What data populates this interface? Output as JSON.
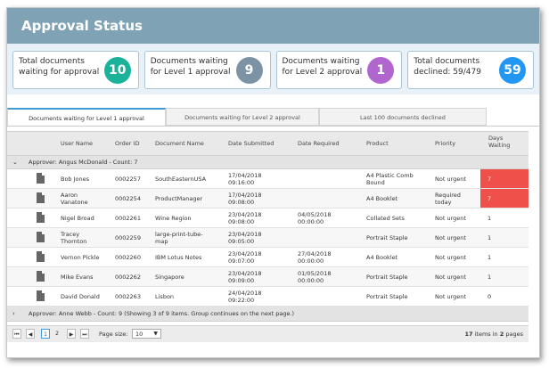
{
  "app_title": "Approval Status",
  "cards": [
    {
      "label_line1": "Total documents",
      "label_line2": "waiting for approval",
      "count": "10",
      "color": "#1ab39a"
    },
    {
      "label_line1": "Documents waiting",
      "label_line2": "for Level 1 approval",
      "count": "9",
      "color": "#7b93a4"
    },
    {
      "label_line1": "Documents waiting",
      "label_line2": "for Level 2 approval",
      "count": "1",
      "color": "#b166cf"
    },
    {
      "label_line1": "Total documents",
      "label_line2": "declined: 59/479",
      "count": "59",
      "color": "#2196f3"
    }
  ],
  "tabs": [
    {
      "label": "Documents waiting for Level 1 approval",
      "active": true
    },
    {
      "label": "Documents waiting for Level 2 approval",
      "active": false
    },
    {
      "label": "Last 100 documents declined",
      "active": false
    }
  ],
  "columns": {
    "user_name": "User Name",
    "order_id": "Order ID",
    "document_name": "Document Name",
    "date_submitted": "Date Submitted",
    "date_required": "Date Required",
    "product": "Product",
    "priority": "Priority",
    "days_waiting_1": "Days",
    "days_waiting_2": "Waiting"
  },
  "group1": {
    "label": "Approver: Angus McDonald - Count: 7"
  },
  "rows": [
    {
      "user1": "Bob Jones",
      "user2": "",
      "order": "0002257",
      "doc1": "SouthEasternUSA",
      "doc2": "",
      "sub1": "17/04/2018",
      "sub2": "09:16:00",
      "req1": "",
      "req2": "",
      "prod1": "A4 Plastic Comb",
      "prod2": "Bound",
      "pri1": "Not urgent",
      "pri2": "",
      "days": "7",
      "hot": true
    },
    {
      "user1": "Aaron",
      "user2": "Vanatone",
      "order": "0002254",
      "doc1": "ProductManager",
      "doc2": "",
      "sub1": "17/04/2018",
      "sub2": "09:08:00",
      "req1": "",
      "req2": "",
      "prod1": "A4 Booklet",
      "prod2": "",
      "pri1": "Required",
      "pri2": "today",
      "days": "7",
      "hot": true
    },
    {
      "user1": "Nigel Broad",
      "user2": "",
      "order": "0002261",
      "doc1": "Wine Region",
      "doc2": "",
      "sub1": "23/04/2018",
      "sub2": "09:08:00",
      "req1": "04/05/2018",
      "req2": "00:00:00",
      "prod1": "Collated Sets",
      "prod2": "",
      "pri1": "Not urgent",
      "pri2": "",
      "days": "1",
      "hot": false
    },
    {
      "user1": "Tracey",
      "user2": "Thornton",
      "order": "0002259",
      "doc1": "large-print-tube-",
      "doc2": "map",
      "sub1": "23/04/2018",
      "sub2": "09:05:00",
      "req1": "",
      "req2": "",
      "prod1": "Portrait Staple",
      "prod2": "",
      "pri1": "Not urgent",
      "pri2": "",
      "days": "1",
      "hot": false
    },
    {
      "user1": "Vernon Pickle",
      "user2": "",
      "order": "0002260",
      "doc1": "IBM Lotus Notes",
      "doc2": "",
      "sub1": "23/04/2018",
      "sub2": "09:07:00",
      "req1": "27/04/2018",
      "req2": "00:00:00",
      "prod1": "A4 Booklet",
      "prod2": "",
      "pri1": "Not urgent",
      "pri2": "",
      "days": "1",
      "hot": false
    },
    {
      "user1": "Mike Evans",
      "user2": "",
      "order": "0002262",
      "doc1": "Singapore",
      "doc2": "",
      "sub1": "23/04/2018",
      "sub2": "09:09:00",
      "req1": "01/05/2018",
      "req2": "00:00:00",
      "prod1": "Portrait Staple",
      "prod2": "",
      "pri1": "Not urgent",
      "pri2": "",
      "days": "1",
      "hot": false
    },
    {
      "user1": "David Donald",
      "user2": "",
      "order": "0002263",
      "doc1": "Lisbon",
      "doc2": "",
      "sub1": "24/04/2018",
      "sub2": "09:22:00",
      "req1": "",
      "req2": "",
      "prod1": "Portrait Staple",
      "prod2": "",
      "pri1": "Not urgent",
      "pri2": "",
      "days": "0",
      "hot": false
    }
  ],
  "group2": {
    "label": "Approver: Anne Webb - Count: 9 (Showing 3 of 9 items. Group continues on the next page.)"
  },
  "pager": {
    "first": "⏮",
    "prev": "◀",
    "page1": "1",
    "page2": "2",
    "next": "▶",
    "last": "⏭",
    "page_size_label": "Page size:",
    "page_size_value": "10",
    "items_count": "17",
    "items_text": "items in",
    "pages_count": "2",
    "pages_text": "pages"
  },
  "colors": {
    "header_bg": "#7fa3b5",
    "hot_days": "#f0504a",
    "tab_active": "#3e9bd6"
  }
}
